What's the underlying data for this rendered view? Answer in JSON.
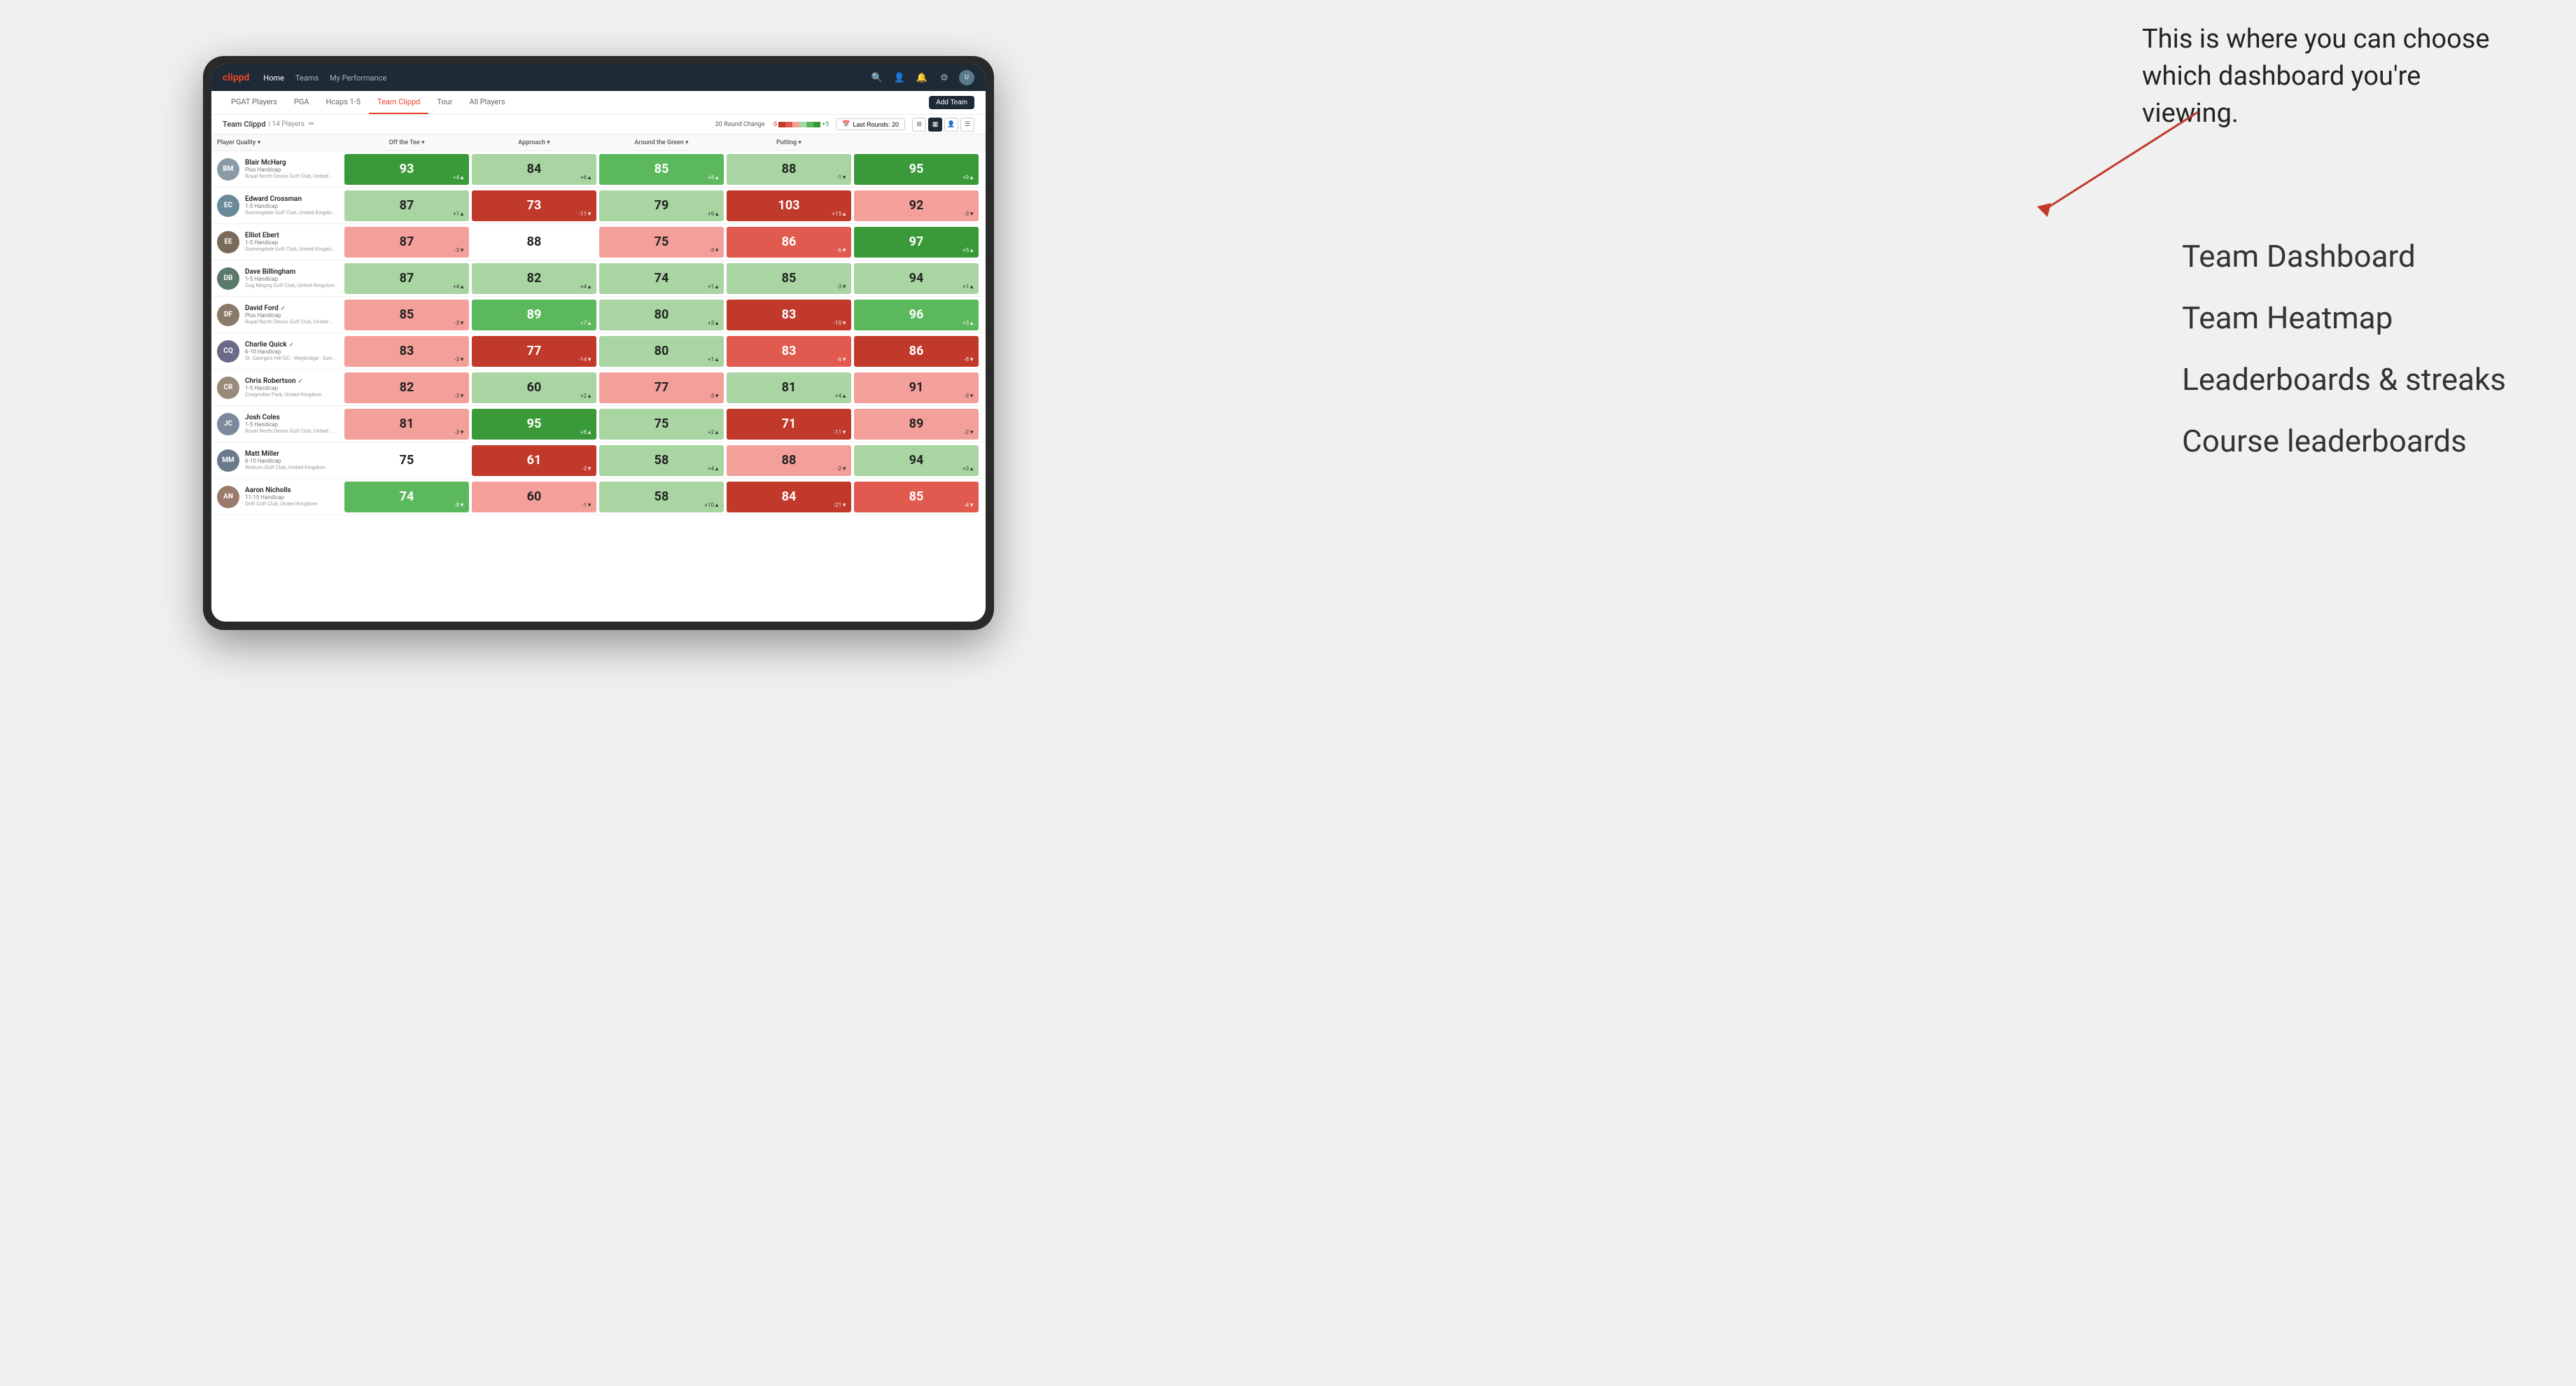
{
  "app": {
    "logo": "clippd",
    "nav": {
      "links": [
        "Home",
        "Teams",
        "My Performance"
      ],
      "icons": [
        "search",
        "person",
        "bell",
        "settings",
        "avatar"
      ]
    },
    "tabs": [
      "PGAT Players",
      "PGA",
      "Hcaps 1-5",
      "Team Clippd",
      "Tour",
      "All Players"
    ],
    "active_tab": "Team Clippd",
    "add_team_label": "Add Team"
  },
  "team": {
    "name": "Team Clippd",
    "separator": "|",
    "count": "14 Players",
    "round_change_label": "20 Round Change",
    "scale_min": "-5",
    "scale_max": "+5",
    "last_rounds_label": "Last Rounds:",
    "last_rounds_value": "20"
  },
  "columns": {
    "player_quality": "Player Quality",
    "off_the_tee": "Off the Tee",
    "approach": "Approach",
    "around_green": "Around the Green",
    "putting": "Putting"
  },
  "players": [
    {
      "name": "Blair McHarg",
      "handicap": "Plus Handicap",
      "club": "Royal North Devon Golf Club, United Kingdom",
      "avatar_color": "#8a9ba8",
      "scores": {
        "player_quality": {
          "value": 93,
          "change": "+4",
          "trend": "up",
          "color": "dark-green"
        },
        "off_tee": {
          "value": 84,
          "change": "+6",
          "trend": "up",
          "color": "light-green"
        },
        "approach": {
          "value": 85,
          "change": "+8",
          "trend": "up",
          "color": "mid-green"
        },
        "around_green": {
          "value": 88,
          "change": "-1",
          "trend": "down",
          "color": "light-green"
        },
        "putting": {
          "value": 95,
          "change": "+9",
          "trend": "up",
          "color": "dark-green"
        }
      }
    },
    {
      "name": "Edward Crossman",
      "handicap": "1-5 Handicap",
      "club": "Sunningdale Golf Club, United Kingdom",
      "avatar_color": "#6a8a9a",
      "scores": {
        "player_quality": {
          "value": 87,
          "change": "+1",
          "trend": "up",
          "color": "light-green"
        },
        "off_tee": {
          "value": 73,
          "change": "-11",
          "trend": "down",
          "color": "dark-red"
        },
        "approach": {
          "value": 79,
          "change": "+9",
          "trend": "up",
          "color": "light-green"
        },
        "around_green": {
          "value": 103,
          "change": "+15",
          "trend": "up",
          "color": "dark-red"
        },
        "putting": {
          "value": 92,
          "change": "-3",
          "trend": "down",
          "color": "light-red"
        }
      }
    },
    {
      "name": "Elliot Ebert",
      "handicap": "1-5 Handicap",
      "club": "Sunningdale Golf Club, United Kingdom",
      "avatar_color": "#7a6a5a",
      "scores": {
        "player_quality": {
          "value": 87,
          "change": "-3",
          "trend": "down",
          "color": "light-red"
        },
        "off_tee": {
          "value": 88,
          "change": "",
          "trend": "",
          "color": "white"
        },
        "approach": {
          "value": 75,
          "change": "-3",
          "trend": "down",
          "color": "light-red"
        },
        "around_green": {
          "value": 86,
          "change": "-6",
          "trend": "down",
          "color": "mid-red"
        },
        "putting": {
          "value": 97,
          "change": "+5",
          "trend": "up",
          "color": "dark-green"
        }
      }
    },
    {
      "name": "Dave Billingham",
      "handicap": "1-5 Handicap",
      "club": "Gog Magog Golf Club, United Kingdom",
      "avatar_color": "#5a7a6a",
      "scores": {
        "player_quality": {
          "value": 87,
          "change": "+4",
          "trend": "up",
          "color": "light-green"
        },
        "off_tee": {
          "value": 82,
          "change": "+4",
          "trend": "up",
          "color": "light-green"
        },
        "approach": {
          "value": 74,
          "change": "+1",
          "trend": "up",
          "color": "light-green"
        },
        "around_green": {
          "value": 85,
          "change": "-3",
          "trend": "down",
          "color": "light-green"
        },
        "putting": {
          "value": 94,
          "change": "+1",
          "trend": "up",
          "color": "light-green"
        }
      }
    },
    {
      "name": "David Ford",
      "handicap": "Plus Handicap",
      "club": "Royal North Devon Golf Club, United Kingdom",
      "avatar_color": "#8a7a6a",
      "verified": true,
      "scores": {
        "player_quality": {
          "value": 85,
          "change": "-3",
          "trend": "down",
          "color": "light-red"
        },
        "off_tee": {
          "value": 89,
          "change": "+7",
          "trend": "up",
          "color": "mid-green"
        },
        "approach": {
          "value": 80,
          "change": "+3",
          "trend": "up",
          "color": "light-green"
        },
        "around_green": {
          "value": 83,
          "change": "-10",
          "trend": "down",
          "color": "dark-red"
        },
        "putting": {
          "value": 96,
          "change": "+3",
          "trend": "up",
          "color": "mid-green"
        }
      }
    },
    {
      "name": "Charlie Quick",
      "handicap": "6-10 Handicap",
      "club": "St. George's Hill GC - Weybridge - Surrey, Uni...",
      "avatar_color": "#6a6a8a",
      "verified": true,
      "scores": {
        "player_quality": {
          "value": 83,
          "change": "-3",
          "trend": "down",
          "color": "light-red"
        },
        "off_tee": {
          "value": 77,
          "change": "-14",
          "trend": "down",
          "color": "dark-red"
        },
        "approach": {
          "value": 80,
          "change": "+1",
          "trend": "up",
          "color": "light-green"
        },
        "around_green": {
          "value": 83,
          "change": "-6",
          "trend": "down",
          "color": "mid-red"
        },
        "putting": {
          "value": 86,
          "change": "-8",
          "trend": "down",
          "color": "dark-red"
        }
      }
    },
    {
      "name": "Chris Robertson",
      "handicap": "1-5 Handicap",
      "club": "Craigmillar Park, United Kingdom",
      "avatar_color": "#9a8a7a",
      "verified": true,
      "scores": {
        "player_quality": {
          "value": 82,
          "change": "-3",
          "trend": "down",
          "color": "light-red"
        },
        "off_tee": {
          "value": 60,
          "change": "+2",
          "trend": "up",
          "color": "light-green"
        },
        "approach": {
          "value": 77,
          "change": "-3",
          "trend": "down",
          "color": "light-red"
        },
        "around_green": {
          "value": 81,
          "change": "+4",
          "trend": "up",
          "color": "light-green"
        },
        "putting": {
          "value": 91,
          "change": "-3",
          "trend": "down",
          "color": "light-red"
        }
      }
    },
    {
      "name": "Josh Coles",
      "handicap": "1-5 Handicap",
      "club": "Royal North Devon Golf Club, United Kingdom",
      "avatar_color": "#7a8a9a",
      "scores": {
        "player_quality": {
          "value": 81,
          "change": "-3",
          "trend": "down",
          "color": "light-red"
        },
        "off_tee": {
          "value": 95,
          "change": "+8",
          "trend": "up",
          "color": "dark-green"
        },
        "approach": {
          "value": 75,
          "change": "+2",
          "trend": "up",
          "color": "light-green"
        },
        "around_green": {
          "value": 71,
          "change": "-11",
          "trend": "down",
          "color": "dark-red"
        },
        "putting": {
          "value": 89,
          "change": "-2",
          "trend": "down",
          "color": "light-red"
        }
      }
    },
    {
      "name": "Matt Miller",
      "handicap": "6-10 Handicap",
      "club": "Woburn Golf Club, United Kingdom",
      "avatar_color": "#6a7a8a",
      "scores": {
        "player_quality": {
          "value": 75,
          "change": "",
          "trend": "",
          "color": "white"
        },
        "off_tee": {
          "value": 61,
          "change": "-3",
          "trend": "down",
          "color": "dark-red"
        },
        "approach": {
          "value": 58,
          "change": "+4",
          "trend": "up",
          "color": "light-green"
        },
        "around_green": {
          "value": 88,
          "change": "-2",
          "trend": "down",
          "color": "light-red"
        },
        "putting": {
          "value": 94,
          "change": "+3",
          "trend": "up",
          "color": "light-green"
        }
      }
    },
    {
      "name": "Aaron Nicholls",
      "handicap": "11-15 Handicap",
      "club": "Drift Golf Club, United Kingdom",
      "avatar_color": "#9a7a6a",
      "scores": {
        "player_quality": {
          "value": 74,
          "change": "-8",
          "trend": "down",
          "color": "mid-green"
        },
        "off_tee": {
          "value": 60,
          "change": "-1",
          "trend": "down",
          "color": "light-red"
        },
        "approach": {
          "value": 58,
          "change": "+10",
          "trend": "up",
          "color": "light-green"
        },
        "around_green": {
          "value": 84,
          "change": "-21",
          "trend": "down",
          "color": "dark-red"
        },
        "putting": {
          "value": 85,
          "change": "-4",
          "trend": "down",
          "color": "mid-red"
        }
      }
    }
  ],
  "annotation": {
    "text": "This is where you can choose which dashboard you're viewing.",
    "labels": [
      "Team Dashboard",
      "Team Heatmap",
      "Leaderboards & streaks",
      "Course leaderboards"
    ]
  }
}
